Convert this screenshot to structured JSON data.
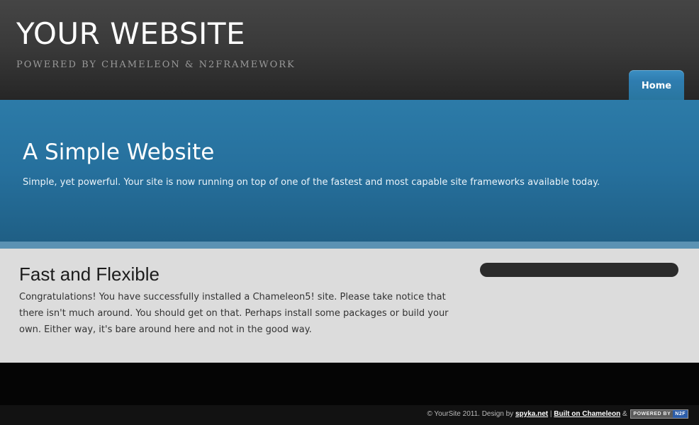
{
  "header": {
    "site_title": "YOUR WEBSITE",
    "tagline": "POWERED BY CHAMELEON & N2FRAMEWORK",
    "nav": [
      {
        "label": "Home",
        "active": true
      }
    ]
  },
  "hero": {
    "title": "A Simple Website",
    "text": "Simple, yet powerful. Your site is now running on top of one of the fastest and most capable site frameworks available today."
  },
  "main": {
    "title": "Fast and Flexible",
    "body": "Congratulations! You have successfully installed a Chameleon5! site. Please take notice that there isn't much around. You should get on that. Perhaps install some packages or build your own. Either way, it's bare around here and not in the good way."
  },
  "footer": {
    "copyright": "© YourSite 2011. Design by",
    "design_link": "spyka.net",
    "separator": "|",
    "built_link": "Built on Chameleon",
    "ampersand": "&",
    "badge_left": "POWERED BY",
    "badge_right": "N2F"
  },
  "colors": {
    "header_dark": "#262626",
    "accent_blue": "#2c7ba8",
    "content_bg": "#dcdcdc"
  }
}
